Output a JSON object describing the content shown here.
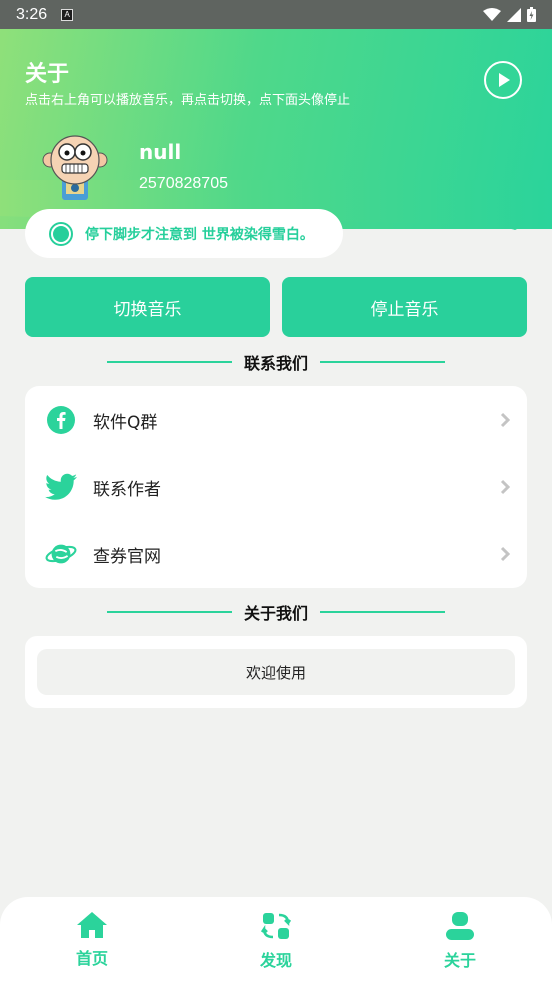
{
  "statusbar": {
    "time": "3:26",
    "notif_glyph": "A"
  },
  "header": {
    "title": "关于",
    "subtitle": "点击右上角可以播放音乐，再点击切换，点下面头像停止",
    "user_name": "null",
    "user_id": "2570828705"
  },
  "quote": {
    "text": "停下脚步才注意到 世界被染得雪白。"
  },
  "actions": {
    "switch_label": "切换音乐",
    "stop_label": "停止音乐"
  },
  "contact": {
    "title": "联系我们",
    "items": [
      {
        "label": "软件Q群",
        "icon": "facebook-icon"
      },
      {
        "label": "联系作者",
        "icon": "twitter-icon"
      },
      {
        "label": "查券官网",
        "icon": "planet-icon"
      }
    ]
  },
  "about": {
    "title": "关于我们",
    "welcome": "欢迎使用"
  },
  "nav": {
    "items": [
      {
        "label": "首页",
        "icon": "home-icon"
      },
      {
        "label": "发现",
        "icon": "discover-icon"
      },
      {
        "label": "关于",
        "icon": "user-icon"
      }
    ]
  },
  "colors": {
    "accent": "#2bd39b",
    "background": "#f1f2f0"
  }
}
